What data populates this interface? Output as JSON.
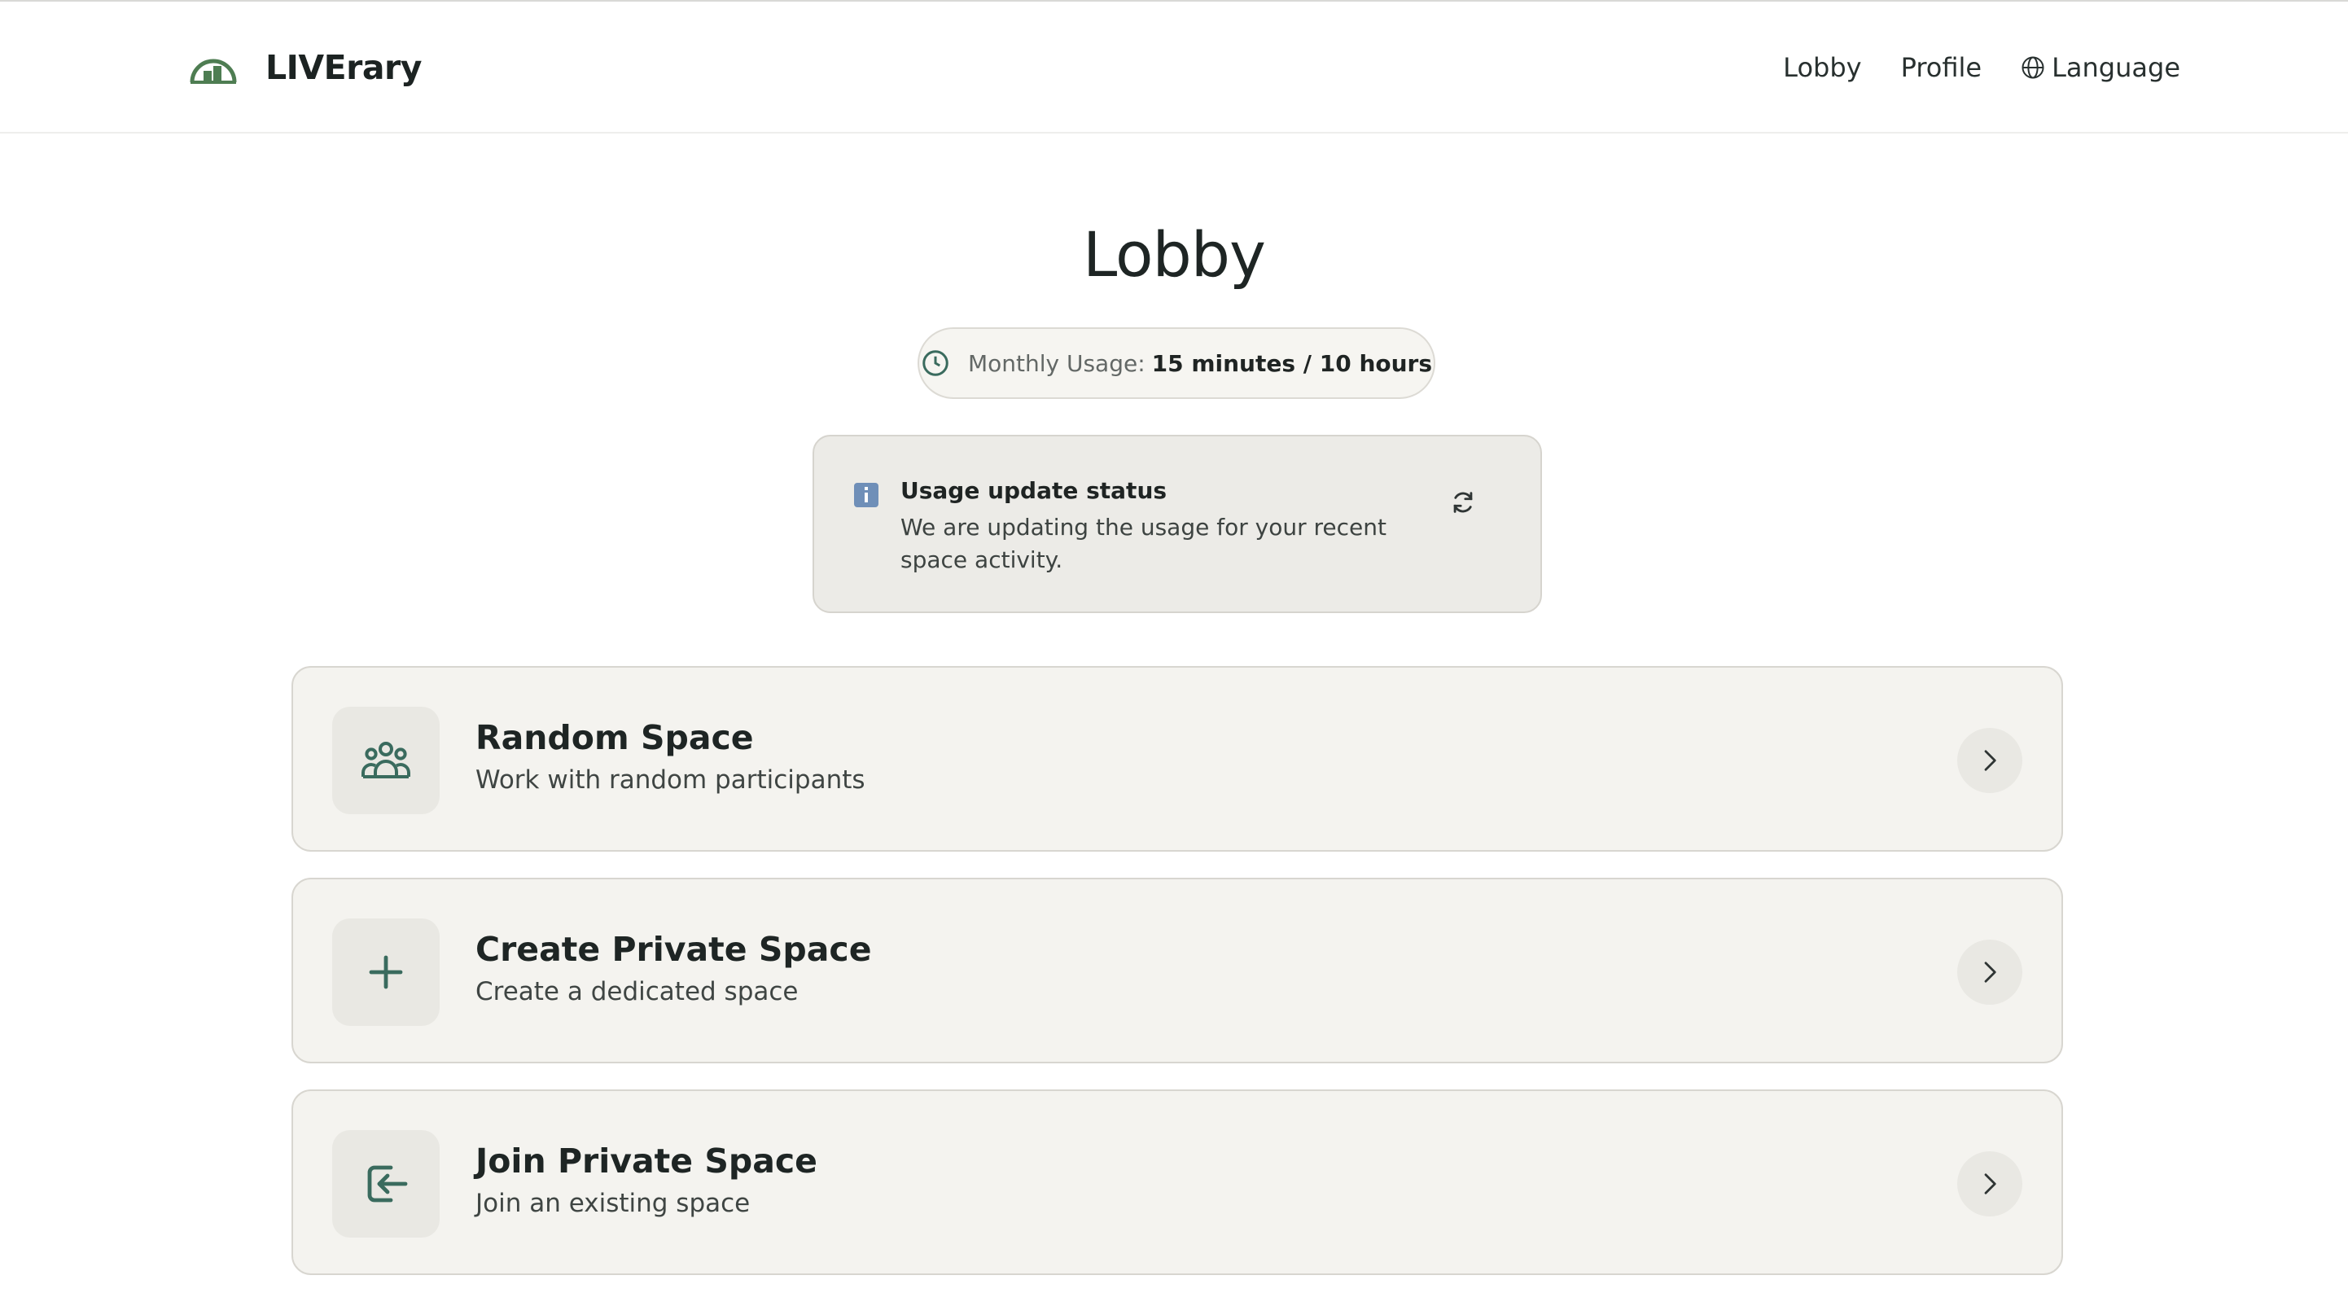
{
  "brand": {
    "name": "LIVErary"
  },
  "nav": {
    "lobby": "Lobby",
    "profile": "Profile",
    "language": "Language"
  },
  "page": {
    "title": "Lobby"
  },
  "usage": {
    "label": "Monthly Usage:",
    "value": "15 minutes / 10 hours"
  },
  "status": {
    "title": "Usage update status",
    "message": "We are updating the usage for your recent space activity."
  },
  "options": [
    {
      "title": "Random Space",
      "description": "Work with random participants",
      "icon": "people-group-icon"
    },
    {
      "title": "Create Private Space",
      "description": "Create a dedicated space",
      "icon": "plus-icon"
    },
    {
      "title": "Join Private Space",
      "description": "Join an existing space",
      "icon": "enter-icon"
    }
  ],
  "colors": {
    "accent": "#3a6b5e",
    "brand_green": "#4e7d52",
    "card_bg": "#f4f3ef",
    "info_blue": "#6f8fb8"
  }
}
